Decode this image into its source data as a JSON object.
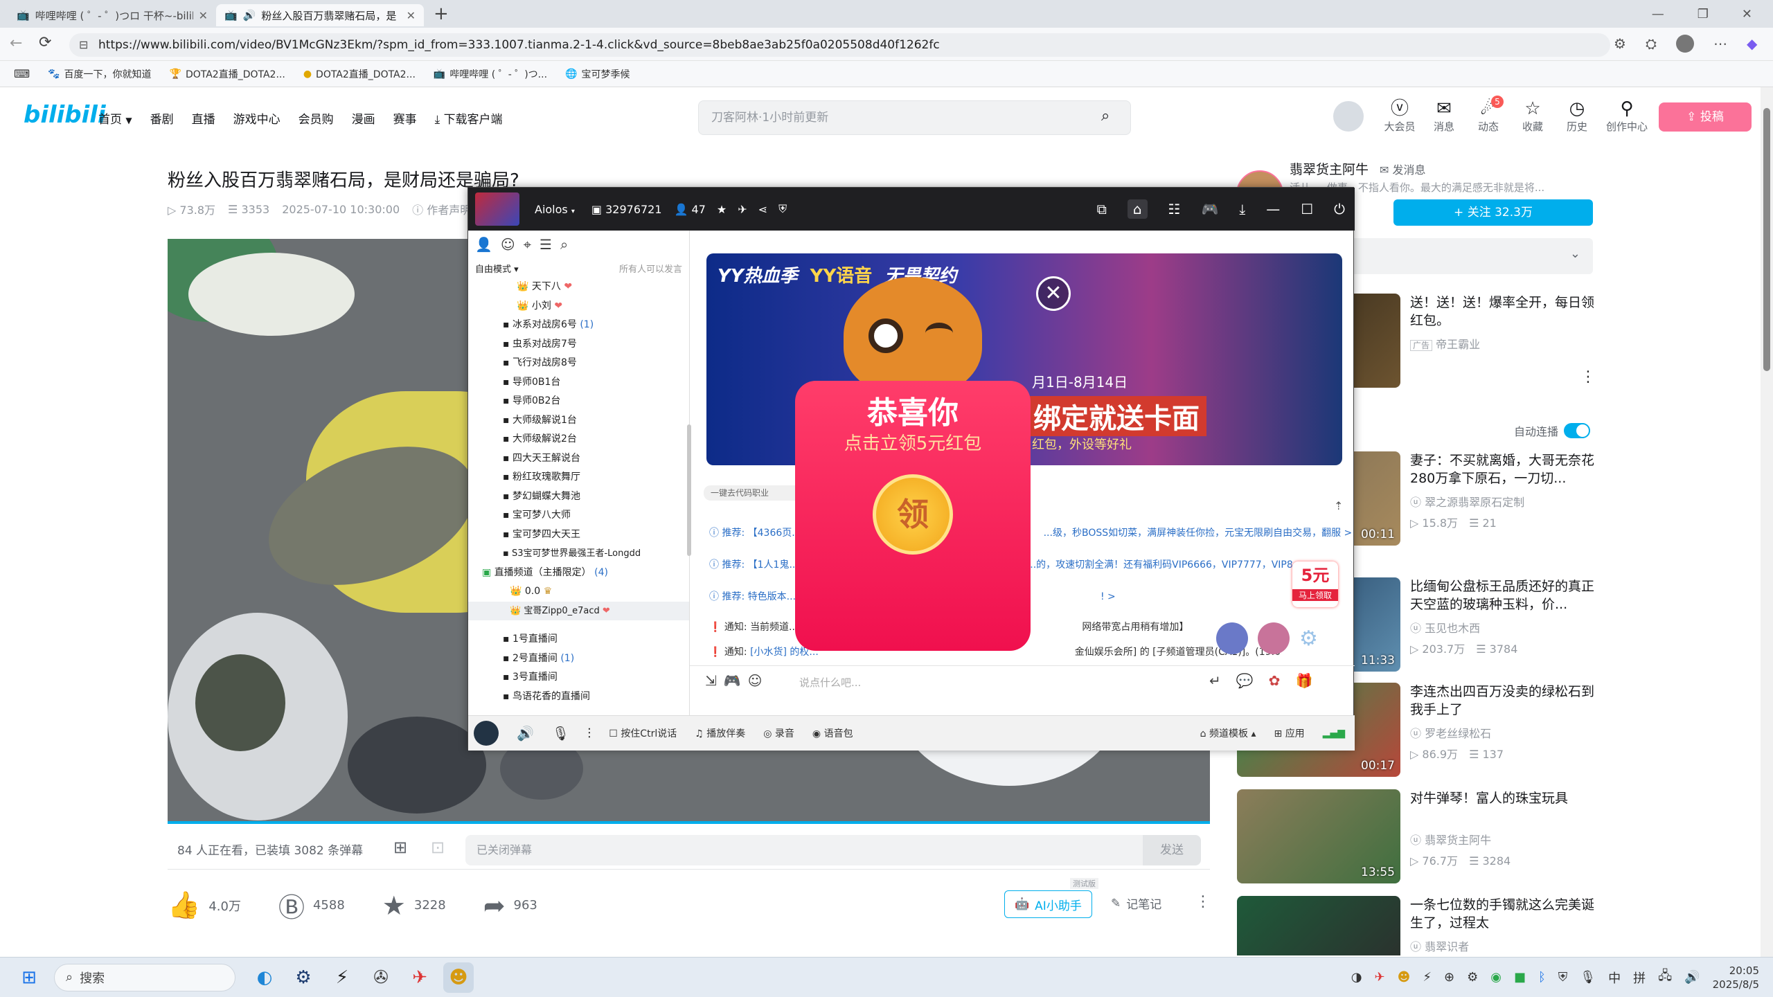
{
  "browser": {
    "tabs": [
      {
        "label": "哔哩哔哩 ( ゜- ゜)つロ 干杯~-bilib"
      },
      {
        "label": "粉丝入股百万翡翠赌石局，是"
      }
    ],
    "new_tab": "+",
    "url": "https://www.bilibili.com/video/BV1McGNz3Ekm/?spm_id_from=333.1007.tianma.2-1-4.click&vd_source=8beb8ae3ab25f0a0205508d40f1262fc",
    "bookmarks": [
      "百度一下，你就知道",
      "DOTA2直播_DOTA2...",
      "DOTA2直播_DOTA2...",
      "哔哩哔哩 ( ゜- ゜)つ...",
      "宝可梦季候"
    ]
  },
  "header": {
    "logo": "bilibili",
    "nav": [
      "首页",
      "番剧",
      "直播",
      "游戏中心",
      "会员购",
      "漫画",
      "赛事",
      "下载客户端"
    ],
    "search_placeholder": "刀客阿林·1小时前更新",
    "icons": [
      {
        "label": "大会员",
        "icon": "vip-icon"
      },
      {
        "label": "消息",
        "icon": "mail-icon"
      },
      {
        "label": "动态",
        "icon": "wind-icon",
        "badge": "5"
      },
      {
        "label": "收藏",
        "icon": "star-icon"
      },
      {
        "label": "历史",
        "icon": "clock-icon"
      },
      {
        "label": "创作中心",
        "icon": "bulb-icon"
      }
    ],
    "upload": "投稿"
  },
  "video": {
    "title": "粉丝入股百万翡翠赌石局，是财局还是骗局?",
    "views": "73.8万",
    "danmaku_count": "3353",
    "date": "2025-07-10 10:30:00",
    "statement": "作者声明",
    "watching": "84 人正在看，已装填 3082 条弹幕",
    "danmaku_placeholder": "已关闭弹幕",
    "send": "发送",
    "likes": "4.0万",
    "coins": "4588",
    "favorites": "3228",
    "shares": "963",
    "ai_tag": "测试版",
    "ai": "AI小助手",
    "notes": "记笔记"
  },
  "uploader": {
    "name": "翡翠货主阿牛",
    "message": "发消息",
    "desc": "活儿 ... 做事，不指人看你。最大的满足感无非就是将...",
    "follow": "+ 关注 32.3万"
  },
  "sidebar": {
    "autoplay": "自动连播",
    "recs": [
      {
        "title": "送！送！送！爆率全开，每日领红包。",
        "author": "帝王霸业",
        "ad": "广告",
        "duration": "",
        "views": "",
        "comments": ""
      },
      {
        "title": "妻子：不买就离婚，大哥无奈花280万拿下原石，一刀切...",
        "author": "翠之源翡翠原石定制",
        "duration": "00:11",
        "views": "15.8万",
        "comments": "21"
      },
      {
        "title": "比缅甸公盘标王品质还好的真正天空蓝的玻璃种玉料，价...",
        "author": "玉见也木西",
        "duration": "11:33",
        "views": "203.7万",
        "comments": "3784"
      },
      {
        "title": "李连杰出四百万没卖的绿松石到我手上了",
        "author": "罗老丝绿松石",
        "duration": "00:17",
        "views": "86.9万",
        "comments": "137"
      },
      {
        "title": "对牛弹琴！富人的珠宝玩具",
        "author": "翡翠货主阿牛",
        "duration": "13:55",
        "views": "76.7万",
        "comments": "3284"
      },
      {
        "title": "一条七位数的手镯就这么完美诞生了，过程太",
        "author": "翡翠识者",
        "duration": "",
        "views": "",
        "comments": ""
      }
    ]
  },
  "yy": {
    "user": "Aiolos",
    "channel_id": "32976721",
    "online": "47",
    "mode": "自由模式",
    "speak": "所有人可以发言",
    "channels": [
      {
        "label": "天下八",
        "sub": true
      },
      {
        "label": "小刘",
        "sub": true
      },
      {
        "label": "冰系对战房6号",
        "count": "(1)"
      },
      {
        "label": "虫系对战房7号"
      },
      {
        "label": "飞行对战房8号"
      },
      {
        "label": "导师0B1台"
      },
      {
        "label": "导师0B2台"
      },
      {
        "label": "大师级解说1台"
      },
      {
        "label": "大师级解说2台"
      },
      {
        "label": "四大天王解说台"
      },
      {
        "label": "粉红玫瑰歌舞厅"
      },
      {
        "label": "梦幻蝴蝶大舞池"
      },
      {
        "label": "宝可梦八大师"
      },
      {
        "label": "宝可梦四大天王"
      },
      {
        "label": "S3宝可梦世界最强王者-Longdd"
      }
    ],
    "live_group": "直播频道（主播限定）",
    "live_count": "(4)",
    "live_users": [
      "0.0",
      "宝哥Zipp0_e7acd"
    ],
    "live_rooms": [
      "1号直播间",
      "2号直播间",
      "3号直播间",
      "鸟语花香的直播间"
    ],
    "live_room2_count": "(1)",
    "banner": {
      "brand1": "YY热血季",
      "brand2": "YY语音",
      "brand3": "无畏契约",
      "date": "月1日-8月14日",
      "main": "绑定就送卡面",
      "sub": "红包，外设等好礼"
    },
    "chat": [
      {
        "tag": "推荐:",
        "text": "【4366页...",
        "tail": "...级，秒BOSS如切菜，满屏神装任你捡，元宝无限刷自由交易，翻服 >"
      },
      {
        "tag": "推荐:",
        "text": "【1人1鬼...",
        "tail": "...的，攻速切割全满！还有福利码VIP6666，VIP7777，VIP8"
      },
      {
        "tag": "推荐:",
        "text": "特色版本...",
        "tail": "!  >"
      },
      {
        "tag": "通知:",
        "text": "当前频道...",
        "tail": "网络带宽占用稍有增加】"
      },
      {
        "tag": "通知:",
        "text": "[小水货] 的权...",
        "tail": "金仙娱乐会所] 的 [子频道管理员(CA1)]。(19:0"
      }
    ],
    "chat_top": "一键去代码职业",
    "input_placeholder": "说点什么吧...",
    "redpack": {
      "title": "恭喜你",
      "sub": "点击立领5元红包",
      "coin": "领"
    },
    "side_pack": {
      "amount": "5元",
      "label": "马上领取"
    },
    "bottom": [
      "按住Ctrl说话",
      "播放伴奏",
      "录音",
      "语音包",
      "频道模板",
      "应用"
    ]
  },
  "taskbar": {
    "search": "搜索",
    "ime": "中",
    "ime2": "拼",
    "time": "20:05",
    "date": "2025/8/5"
  }
}
